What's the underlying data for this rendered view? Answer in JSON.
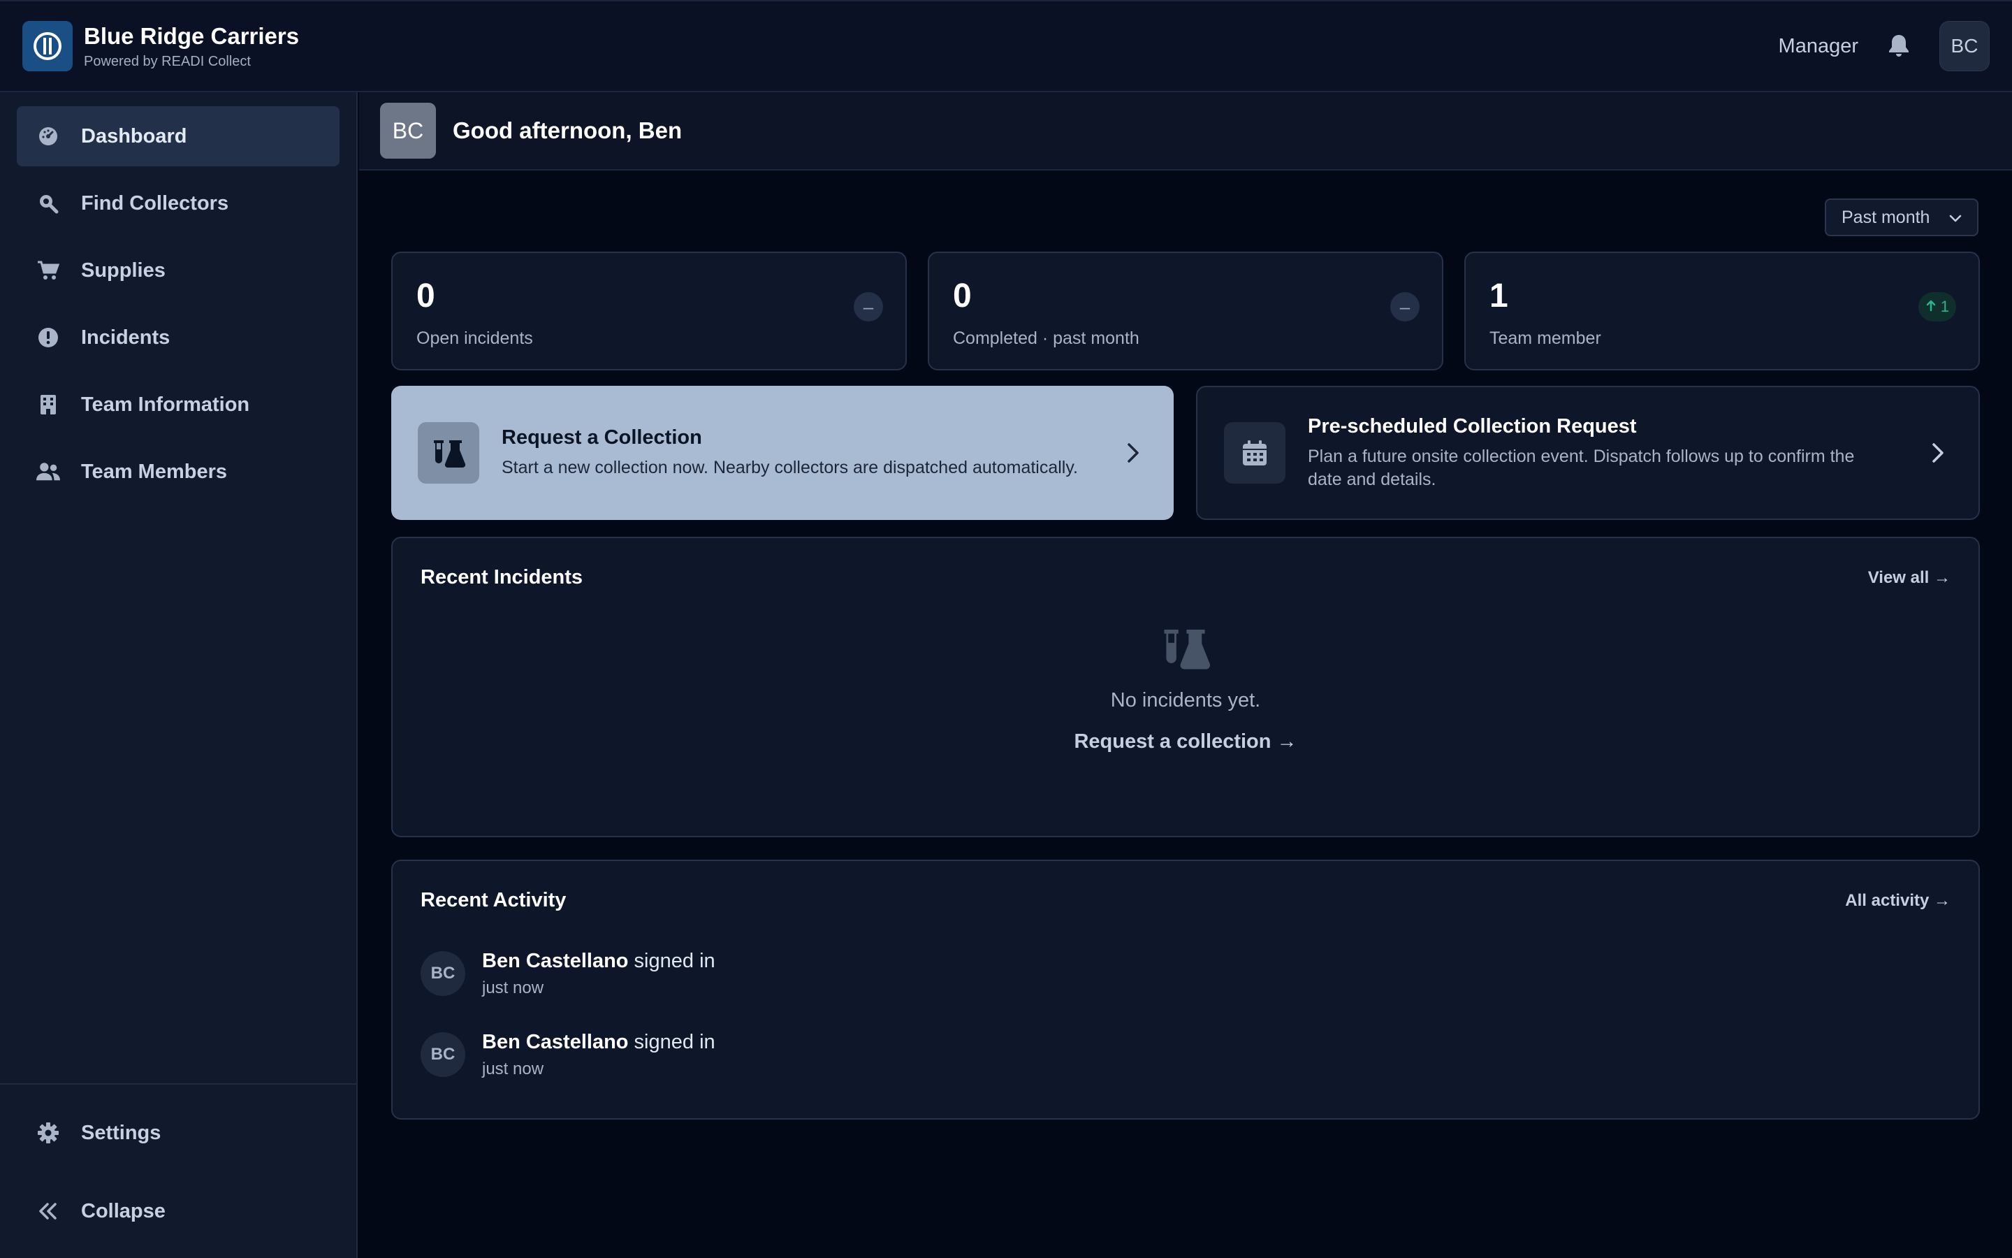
{
  "brand": {
    "name": "Blue Ridge Carriers",
    "subtitle": "Powered by READI Collect"
  },
  "topbar": {
    "role": "Manager",
    "avatar_initials": "BC"
  },
  "sidebar": {
    "items": [
      {
        "label": "Dashboard",
        "icon": "dashboard-icon",
        "active": true
      },
      {
        "label": "Find Collectors",
        "icon": "search-icon"
      },
      {
        "label": "Supplies",
        "icon": "cart-icon"
      },
      {
        "label": "Incidents",
        "icon": "alert-icon"
      },
      {
        "label": "Team Information",
        "icon": "building-icon"
      },
      {
        "label": "Team Members",
        "icon": "users-icon"
      }
    ],
    "bottom": [
      {
        "label": "Settings",
        "icon": "gear-icon"
      },
      {
        "label": "Collapse",
        "icon": "collapse-icon"
      }
    ]
  },
  "greeting": {
    "avatar_initials": "BC",
    "text": "Good afternoon, Ben"
  },
  "filter": {
    "period": "Past month"
  },
  "stats": [
    {
      "value": "0",
      "label": "Open incidents",
      "badge": "–"
    },
    {
      "value": "0",
      "label": "Completed · past month",
      "badge": "–"
    },
    {
      "value": "1",
      "label": "Team member",
      "badge": "1",
      "trend": "up"
    }
  ],
  "actions": {
    "primary": {
      "title": "Request a Collection",
      "desc": "Start a new collection now. Nearby collectors are dispatched automatically."
    },
    "secondary": {
      "title": "Pre-scheduled Collection Request",
      "desc": "Plan a future onsite collection event. Dispatch follows up to confirm the date and details."
    }
  },
  "recent_incidents": {
    "title": "Recent Incidents",
    "link": "View all →",
    "empty_text": "No incidents yet.",
    "empty_link": "Request a collection →"
  },
  "recent_activity": {
    "title": "Recent Activity",
    "link": "All activity →",
    "items": [
      {
        "initials": "BC",
        "name": "Ben Castellano",
        "action": " signed in",
        "time": "just now"
      },
      {
        "initials": "BC",
        "name": "Ben Castellano",
        "action": " signed in",
        "time": "just now"
      }
    ]
  },
  "colors": {
    "accent": "#a9bbd3",
    "brand": "#1a4f85",
    "positive": "#2bb58c"
  }
}
